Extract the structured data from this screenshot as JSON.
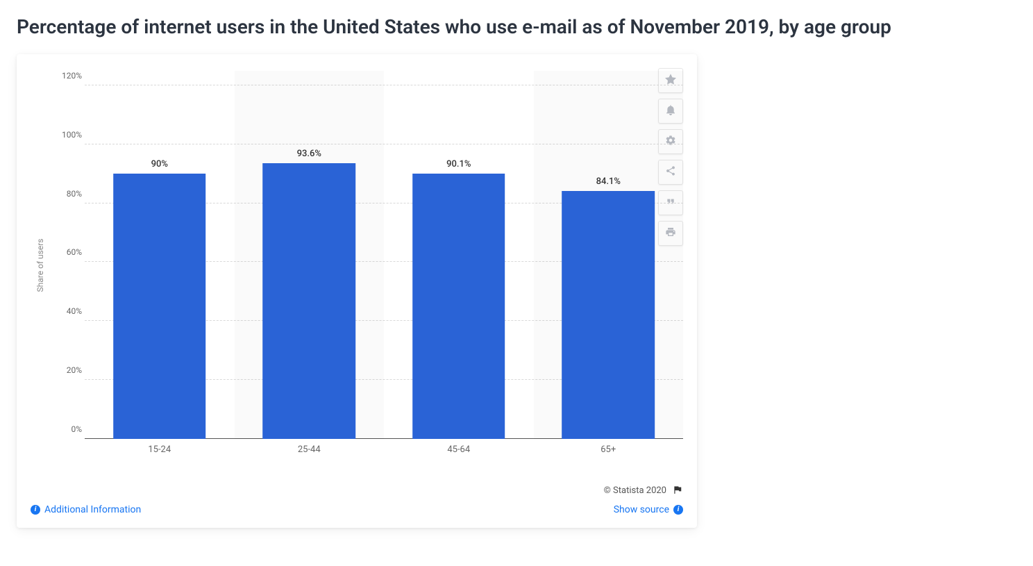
{
  "title": "Percentage of internet users in the United States who use e-mail as of November 2019, by age group",
  "chart_data": {
    "type": "bar",
    "categories": [
      "15-24",
      "25-44",
      "45-64",
      "65+"
    ],
    "values": [
      90,
      93.6,
      90.1,
      84.1
    ],
    "value_labels": [
      "90%",
      "93.6%",
      "90.1%",
      "84.1%"
    ],
    "ylabel": "Share of users",
    "xlabel": "",
    "ylim": [
      0,
      125
    ],
    "yticks": [
      0,
      20,
      40,
      60,
      80,
      100,
      120
    ],
    "ytick_labels": [
      "0%",
      "20%",
      "40%",
      "60%",
      "80%",
      "100%",
      "120%"
    ],
    "bar_color": "#2a63d6"
  },
  "actions": {
    "favorite": "favorite",
    "notify": "notify",
    "settings": "settings",
    "share": "share",
    "cite": "cite",
    "print": "print"
  },
  "footer": {
    "additional_info": "Additional Information",
    "show_source": "Show source",
    "copyright": "© Statista 2020"
  }
}
